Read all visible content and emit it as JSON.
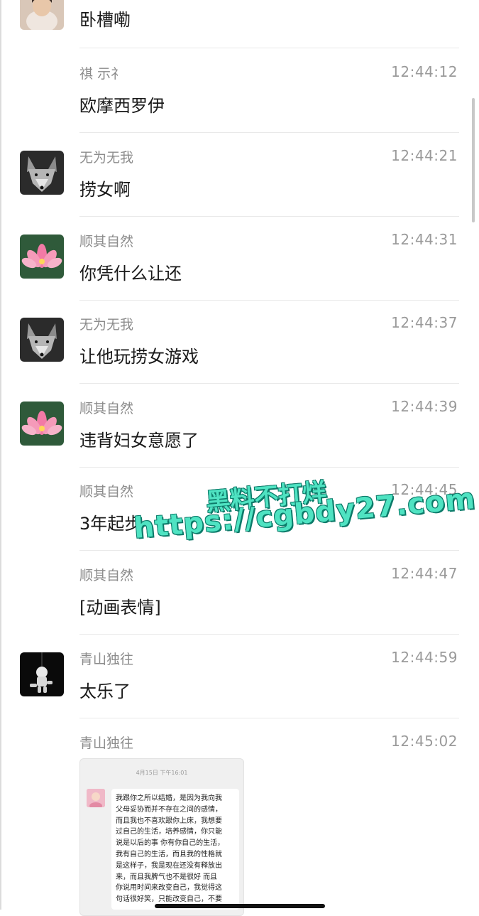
{
  "messages": [
    {
      "sender": "",
      "time": "",
      "text": "卧槽嘞",
      "avatar": "person-photo-icon"
    },
    {
      "sender": "祺 示礻",
      "time": "12:44:12",
      "text": "欧摩西罗伊",
      "avatar": ""
    },
    {
      "sender": "无为无我",
      "time": "12:44:21",
      "text": "捞女啊",
      "avatar": "wolf-icon"
    },
    {
      "sender": "顺其自然",
      "time": "12:44:31",
      "text": "你凭什么让还",
      "avatar": "lotus-icon"
    },
    {
      "sender": "无为无我",
      "time": "12:44:37",
      "text": "让他玩捞女游戏",
      "avatar": "wolf-icon"
    },
    {
      "sender": "顺其自然",
      "time": "12:44:39",
      "text": "违背妇女意愿了",
      "avatar": "lotus-icon"
    },
    {
      "sender": "顺其自然",
      "time": "12:44:45",
      "text": "3年起步",
      "avatar": ""
    },
    {
      "sender": "顺其自然",
      "time": "12:44:47",
      "text": "[动画表情]",
      "avatar": ""
    },
    {
      "sender": "青山独往",
      "time": "12:44:59",
      "text": "太乐了",
      "avatar": "astronaut-icon"
    },
    {
      "sender": "青山独往",
      "time": "12:45:02",
      "text": "",
      "avatar": ""
    }
  ],
  "watermark": {
    "line1": "黑料不打烊",
    "line2": "https://cgbdy27.com"
  },
  "image_message": {
    "timestamp": "4月15日 下午16:01",
    "text": "我跟你之所以结婚，是因为我向我\n父母妥协而并不存在之间的感情，\n而且我也不喜欢跟你上床，我想要\n过自己的生活，培养感情，你只能\n说是以后的事 你有你自己的生活，\n我有自己的生活，而且我的性格就\n是这样子，我是现在还没有释放出\n来，而且我脾气也不是很好 而且\n你说用时间来改变自己，我觉得这\n句话很好笑，只能改变自己，不要"
  },
  "colors": {
    "watermark": "#4fe3c2",
    "watermark_outline": "#0c7a69"
  }
}
